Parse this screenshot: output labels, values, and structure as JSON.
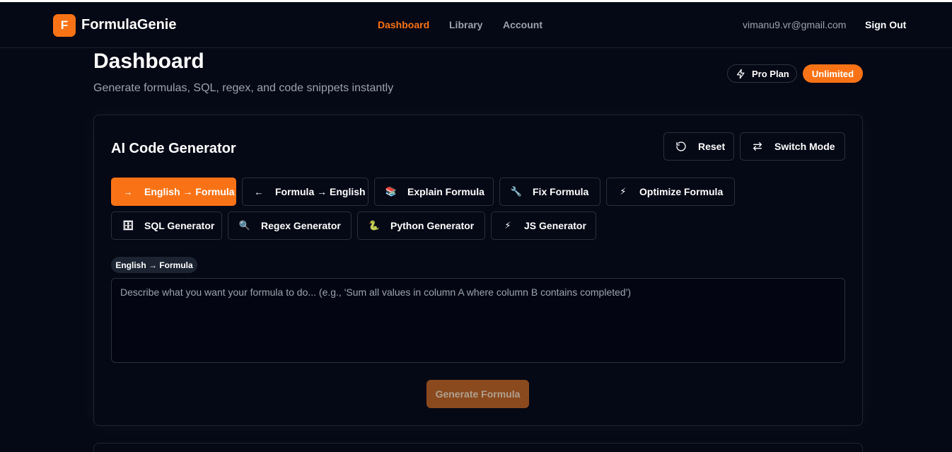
{
  "header": {
    "logo_letter": "F",
    "app_name": "FormulaGenie",
    "nav": [
      "Dashboard",
      "Library",
      "Account"
    ],
    "user_email": "vimanu9.vr@gmail.com",
    "sign_out": "Sign Out"
  },
  "page": {
    "title": "Dashboard",
    "subtitle": "Generate formulas, SQL, regex, and code snippets instantly",
    "plan_label": "Pro Plan",
    "plan_badge": "Unlimited"
  },
  "generator": {
    "title": "AI Code Generator",
    "reset_label": "Reset",
    "switch_label": "Switch Mode",
    "modes": [
      {
        "icon": "→",
        "label": "English → Formula",
        "active": true
      },
      {
        "icon": "←",
        "label": "Formula → English",
        "active": false
      },
      {
        "icon": "📚",
        "label": "Explain Formula",
        "active": false
      },
      {
        "icon": "🔧",
        "label": "Fix Formula",
        "active": false
      },
      {
        "icon": "⚡",
        "label": "Optimize Formula",
        "active": false
      },
      {
        "icon": "🗄",
        "label": "SQL Generator",
        "active": false
      },
      {
        "icon": "🔍",
        "label": "Regex Generator",
        "active": false
      },
      {
        "icon": "🐍",
        "label": "Python Generator",
        "active": false
      },
      {
        "icon": "⚡",
        "label": "JS Generator",
        "active": false
      }
    ],
    "current_mode_tag": "English → Formula",
    "prompt_placeholder": "Describe what you want your formula to do... (e.g., 'Sum all values in column A where column B contains completed')",
    "prompt_value": "",
    "generate_label": "Generate Formula"
  },
  "colors": {
    "accent": "#f97316",
    "background": "#050815"
  }
}
